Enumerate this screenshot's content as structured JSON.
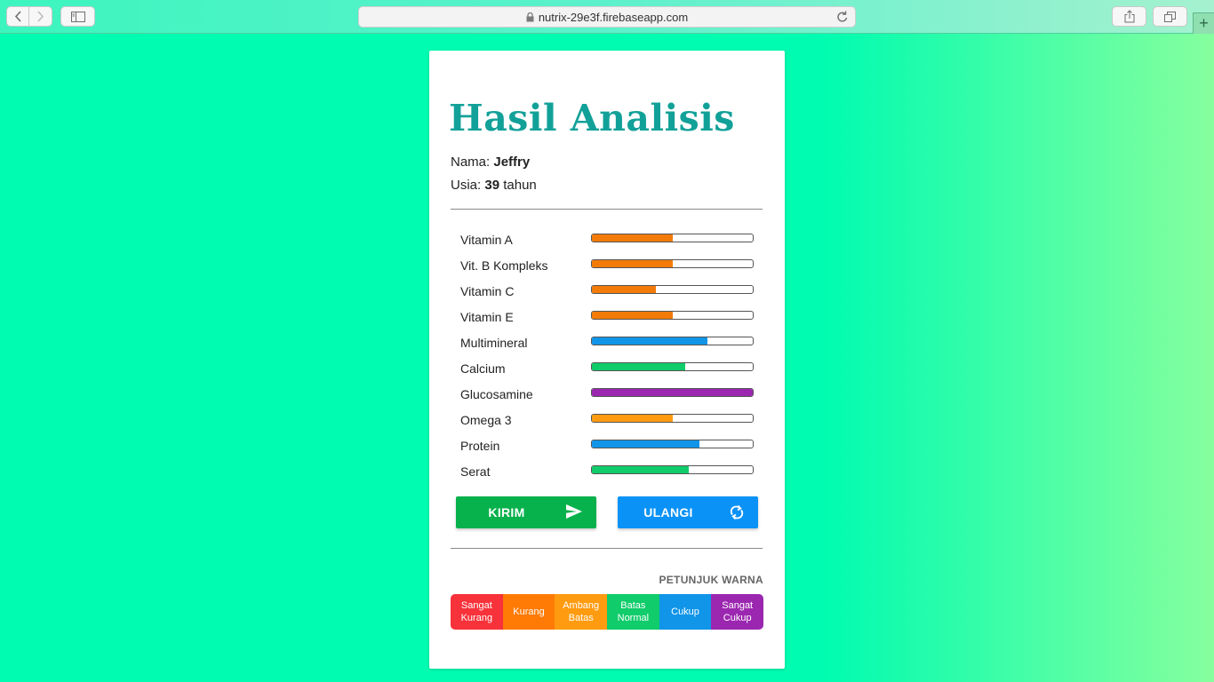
{
  "browser": {
    "url": "nutrix-29e3f.firebaseapp.com"
  },
  "page": {
    "title": "Hasil Analisis",
    "name_label": "Nama:",
    "name_value": "Jeffry",
    "age_label": "Usia:",
    "age_value": "39",
    "age_unit": "tahun"
  },
  "colors": {
    "sangat_kurang": "#f7323a",
    "kurang": "#ff7b06",
    "ambang_batas": "#ff9b10",
    "batas_normal": "#10cc6a",
    "cukup": "#1195e8",
    "sangat_cukup": "#9b27b0",
    "kirim_button": "#07b14c",
    "ulangi_button": "#0b92f6",
    "title": "#12a199"
  },
  "nutrients": [
    {
      "label": "Vitamin A",
      "level": 0.5,
      "color": "#f37b09"
    },
    {
      "label": "Vit. B Kompleks",
      "level": 0.5,
      "color": "#f37b09"
    },
    {
      "label": "Vitamin C",
      "level": 0.4,
      "color": "#f37b09"
    },
    {
      "label": "Vitamin E",
      "level": 0.5,
      "color": "#f37b09"
    },
    {
      "label": "Multimineral",
      "level": 0.72,
      "color": "#1195e8"
    },
    {
      "label": "Calcium",
      "level": 0.58,
      "color": "#10cc6a"
    },
    {
      "label": "Glucosamine",
      "level": 1.0,
      "color": "#9b27b0"
    },
    {
      "label": "Omega 3",
      "level": 0.5,
      "color": "#ff9b10"
    },
    {
      "label": "Protein",
      "level": 0.67,
      "color": "#1195e8"
    },
    {
      "label": "Serat",
      "level": 0.6,
      "color": "#10cc6a"
    }
  ],
  "buttons": {
    "kirim": "KIRIM",
    "ulangi": "ULANGI"
  },
  "legend": {
    "title": "PETUNJUK WARNA",
    "items": [
      {
        "line1": "Sangat",
        "line2": "Kurang",
        "color": "#f7323a"
      },
      {
        "line1": "Kurang",
        "line2": "",
        "color": "#ff7b06"
      },
      {
        "line1": "Ambang",
        "line2": "Batas",
        "color": "#ff9b10"
      },
      {
        "line1": "Batas",
        "line2": "Normal",
        "color": "#10cc6a"
      },
      {
        "line1": "Cukup",
        "line2": "",
        "color": "#1195e8"
      },
      {
        "line1": "Sangat",
        "line2": "Cukup",
        "color": "#9b27b0"
      }
    ]
  }
}
